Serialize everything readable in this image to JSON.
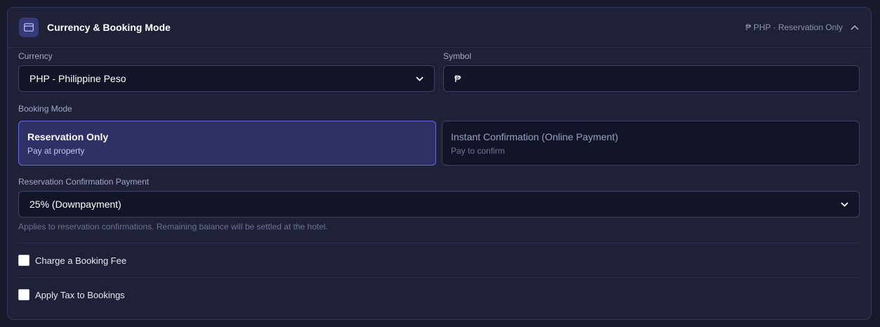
{
  "section": {
    "title": "Currency & Booking Mode",
    "summary": "₱ PHP · Reservation Only",
    "icon": "credit-card-icon",
    "accent": "#6a6bd8"
  },
  "currency": {
    "label": "Currency",
    "selected": "PHP - Philippine Peso"
  },
  "symbol": {
    "label": "Symbol",
    "value": "₱"
  },
  "booking_mode": {
    "label": "Booking Mode",
    "options": [
      {
        "title": "Reservation Only",
        "subtitle": "Pay at property",
        "selected": true
      },
      {
        "title": "Instant Confirmation (Online Payment)",
        "subtitle": "Pay to confirm",
        "selected": false
      }
    ]
  },
  "reservation_payment": {
    "label": "Reservation Confirmation Payment",
    "selected": "25% (Downpayment)",
    "help": "Applies to reservation confirmations. Remaining balance will be settled at the hotel."
  },
  "booking_fee": {
    "label": "Charge a Booking Fee",
    "checked": false
  },
  "tax": {
    "label": "Apply Tax to Bookings",
    "checked": false
  }
}
